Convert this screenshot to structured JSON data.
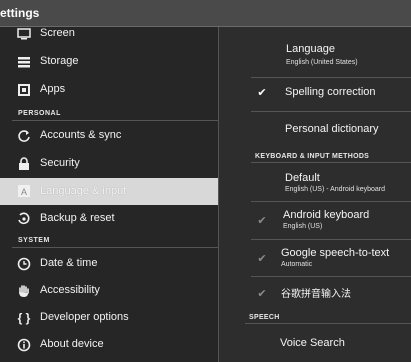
{
  "app": {
    "title": "ettings"
  },
  "left": {
    "items": [
      {
        "label": "Screen",
        "icon": "screen-icon"
      },
      {
        "label": "Storage",
        "icon": "storage-icon"
      },
      {
        "label": "Apps",
        "icon": "apps-icon"
      },
      {
        "label": "Accounts & sync",
        "icon": "sync-icon"
      },
      {
        "label": "Security",
        "icon": "lock-icon"
      },
      {
        "label": "Language & input",
        "icon": "language-icon",
        "selected": true
      },
      {
        "label": "Backup & reset",
        "icon": "backup-icon"
      },
      {
        "label": "Date & time",
        "icon": "clock-icon"
      },
      {
        "label": "Accessibility",
        "icon": "hand-icon"
      },
      {
        "label": "Developer options",
        "icon": "braces-icon"
      },
      {
        "label": "About device",
        "icon": "info-icon"
      }
    ],
    "sections": {
      "personal": "PERSONAL",
      "system": "SYSTEM"
    }
  },
  "right": {
    "language": {
      "title": "Language",
      "summary": "English (United States)"
    },
    "spelling": {
      "title": "Spelling correction",
      "checked": true
    },
    "dictionary": {
      "title": "Personal dictionary"
    },
    "keyboard_section": "KEYBOARD & INPUT METHODS",
    "default": {
      "title": "Default",
      "summary": "English (US) - Android keyboard"
    },
    "android_keyboard": {
      "title": "Android keyboard",
      "summary": "English (US)",
      "checked": true
    },
    "google_voice": {
      "title": "Google speech-to-text",
      "summary": "Automatic",
      "checked": true
    },
    "chinese_ime": {
      "title": "谷歌拼音输入法",
      "checked": true
    },
    "speech_section": "SPEECH",
    "voice_search": {
      "title": "Voice Search"
    }
  },
  "colors": {
    "selected_bg": "#d8d8d8",
    "background": "#2a2a2a"
  }
}
